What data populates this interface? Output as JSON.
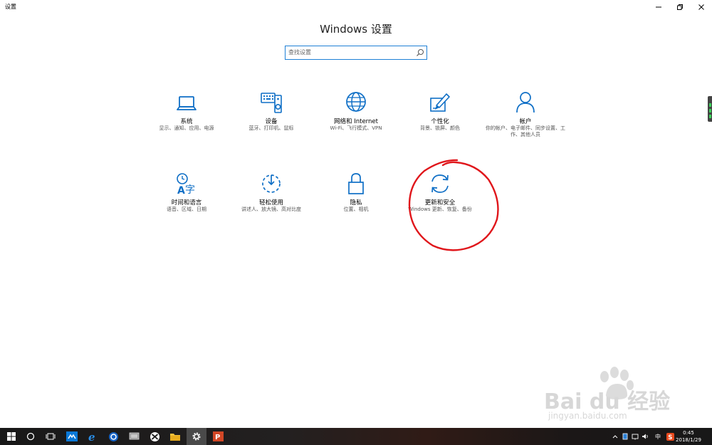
{
  "window": {
    "title": "设置",
    "controls": [
      "minimize-icon",
      "restore-icon",
      "close-icon"
    ]
  },
  "page": {
    "title": "Windows 设置"
  },
  "search": {
    "placeholder": "查找设置",
    "icon": "search-icon"
  },
  "accent_color": "#0f6fc6",
  "tiles": [
    {
      "id": "system",
      "icon": "laptop-icon",
      "name": "系统",
      "desc": "显示、通知、应用、电源"
    },
    {
      "id": "devices",
      "icon": "keyboard-speaker-icon",
      "name": "设备",
      "desc": "蓝牙、打印机、鼠标"
    },
    {
      "id": "network",
      "icon": "globe-icon",
      "name": "网络和 Internet",
      "desc": "Wi-Fi、飞行模式、VPN"
    },
    {
      "id": "personalization",
      "icon": "paint-pen-icon",
      "name": "个性化",
      "desc": "背景、锁屏、颜色"
    },
    {
      "id": "accounts",
      "icon": "person-icon",
      "name": "帐户",
      "desc": "你的帐户、电子邮件、同步设置、工作、其他人员"
    },
    {
      "id": "time-language",
      "icon": "clock-language-icon",
      "name": "时间和语言",
      "desc": "语音、区域、日期"
    },
    {
      "id": "ease-of-access",
      "icon": "ease-of-access-icon",
      "name": "轻松使用",
      "desc": "讲述人、放大镜、高对比度"
    },
    {
      "id": "privacy",
      "icon": "lock-icon",
      "name": "隐私",
      "desc": "位置、相机"
    },
    {
      "id": "update-security",
      "icon": "sync-arrows-icon",
      "name": "更新和安全",
      "desc": "Windows 更新、恢复、备份"
    }
  ],
  "annotation": {
    "color": "#e0161b",
    "target": "update-security"
  },
  "watermark": {
    "brand": "Bai du 经验",
    "url": "jingyan.baidu.com"
  },
  "taskbar": {
    "items": [
      "windows-start-icon",
      "cortana-circle-icon",
      "task-view-icon",
      "store-app-icon",
      "edge-icon",
      "browser-icon",
      "app-icon",
      "xbox-icon",
      "file-explorer-icon",
      "settings-gear-icon",
      "powerpoint-icon"
    ],
    "active": "settings-gear-icon",
    "tray": {
      "ime": "中",
      "time": "0:45",
      "date": "2018/1/29"
    }
  }
}
